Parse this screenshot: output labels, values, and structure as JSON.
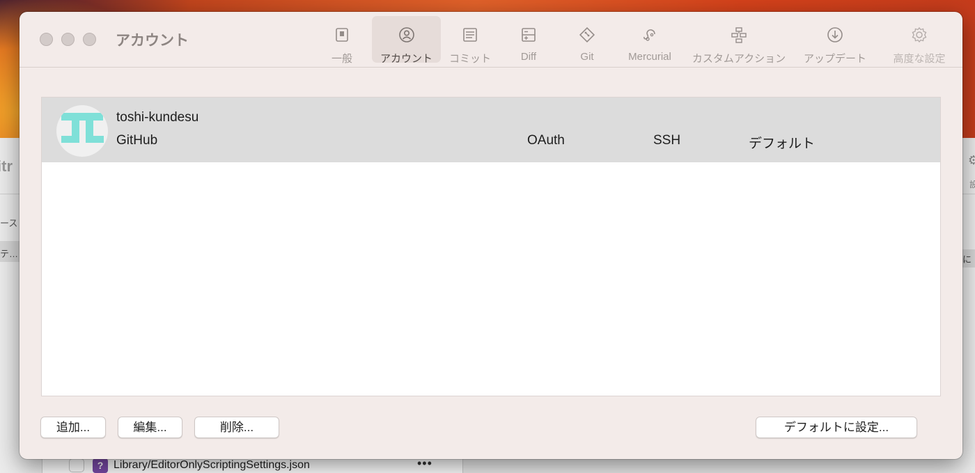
{
  "background_window": {
    "title_fragment": "itr",
    "left_item_1": "ース",
    "left_item_2": "テ…",
    "right_label": "設",
    "right_item": "に和",
    "file_row": {
      "badge": "?",
      "filename": "Library/EditorOnlyScriptingSettings.json",
      "more": "•••"
    }
  },
  "window": {
    "title": "アカウント"
  },
  "toolbar": {
    "items": [
      {
        "label": "一般",
        "icon": "general-icon"
      },
      {
        "label": "アカウント",
        "icon": "account-icon",
        "selected": true
      },
      {
        "label": "コミット",
        "icon": "commit-icon"
      },
      {
        "label": "Diff",
        "icon": "diff-icon"
      },
      {
        "label": "Git",
        "icon": "git-icon"
      },
      {
        "label": "Mercurial",
        "icon": "mercurial-icon"
      },
      {
        "label": "カスタムアクション",
        "icon": "custom-actions-icon"
      },
      {
        "label": "アップデート",
        "icon": "update-icon"
      },
      {
        "label": "高度な設定",
        "icon": "gear-icon"
      }
    ]
  },
  "accounts": [
    {
      "username": "toshi-kundesu",
      "host": "GitHub",
      "auth": "OAuth",
      "protocol": "SSH",
      "default": "デフォルト",
      "selected": true
    }
  ],
  "buttons": {
    "add": "追加...",
    "edit": "編集...",
    "delete": "削除...",
    "set_default": "デフォルトに設定..."
  },
  "colors": {
    "window_bg": "#f3ebe9",
    "selected_row": "#dcdcdc",
    "avatar_accent": "#7fe0d8"
  }
}
